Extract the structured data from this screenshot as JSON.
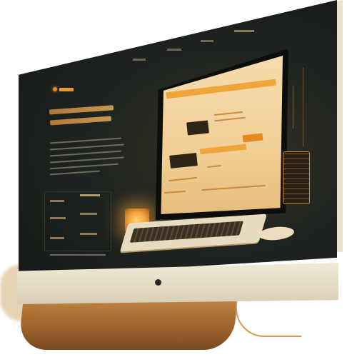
{
  "scene": {
    "nav_links": [
      "",
      "",
      "",
      ""
    ],
    "headline_lines": [
      "",
      ""
    ],
    "left_labels": [
      "",
      "",
      "",
      ""
    ],
    "inner_buttons": [
      "",
      ""
    ]
  },
  "colors": {
    "accent": "#f0a53c",
    "screen_bg": "#1f2420",
    "bezel": "#e8e2cf",
    "stand": "#9a5a1c"
  }
}
